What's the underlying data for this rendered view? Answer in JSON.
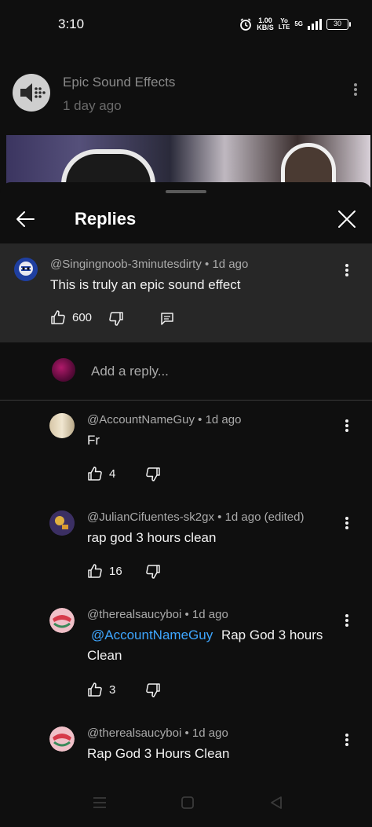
{
  "status_bar": {
    "time": "3:10",
    "net_speed_value": "1.00",
    "net_speed_unit": "KB/S",
    "volte_top": "Yo",
    "volte_bottom": "LTE",
    "network": "5G",
    "battery": "30"
  },
  "background_post": {
    "channel_name": "Epic Sound Effects",
    "age": "1 day ago"
  },
  "sheet": {
    "title": "Replies"
  },
  "parent_comment": {
    "author": "@Singingnoob-3minutesdirty",
    "age": "1d ago",
    "text": "This is truly an epic sound effect",
    "likes": "600"
  },
  "add_reply": {
    "placeholder": "Add a reply..."
  },
  "replies": [
    {
      "author": "@AccountNameGuy",
      "age": "1d ago",
      "text": "Fr",
      "likes": "4"
    },
    {
      "author": "@JulianCifuentes-sk2gx",
      "age": "1d ago (edited)",
      "text": "rap god 3 hours clean",
      "likes": "16"
    },
    {
      "author": "@therealsaucyboi",
      "age": "1d ago",
      "mention": "@AccountNameGuy",
      "text_line1": "Rap God 3 hours",
      "text_line2": "Clean",
      "likes": "3"
    },
    {
      "author": "@therealsaucyboi",
      "age": "1d ago",
      "text": "Rap God 3 Hours Clean"
    }
  ],
  "separator": "•",
  "icons": {
    "back": "arrow-left-icon",
    "close": "close-icon",
    "like": "thumbs-up-icon",
    "dislike": "thumbs-down-icon",
    "reply": "reply-icon",
    "more": "more-vert-icon",
    "nav_recents": "recents-icon",
    "nav_home": "home-icon",
    "nav_back": "nav-back-icon"
  },
  "colors": {
    "background": "#0f0f0f",
    "highlight_row": "#272727",
    "mention": "#3ea6ff",
    "meta_text": "#aaaaaa"
  }
}
